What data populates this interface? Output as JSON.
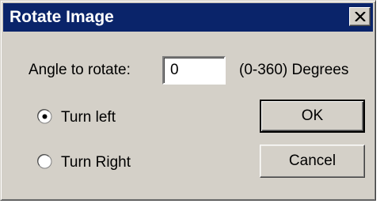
{
  "window": {
    "title": "Rotate Image",
    "close_icon": "close-icon"
  },
  "angle": {
    "label": "Angle to rotate:",
    "value": "0",
    "range_hint": "(0-360) Degrees"
  },
  "direction": {
    "options": [
      {
        "label": "Turn left",
        "selected": true
      },
      {
        "label": "Turn Right",
        "selected": false
      }
    ]
  },
  "buttons": {
    "ok_label": "OK",
    "cancel_label": "Cancel"
  },
  "colors": {
    "titlebar": "#0a246a",
    "dialog_face": "#d4d0c8"
  }
}
